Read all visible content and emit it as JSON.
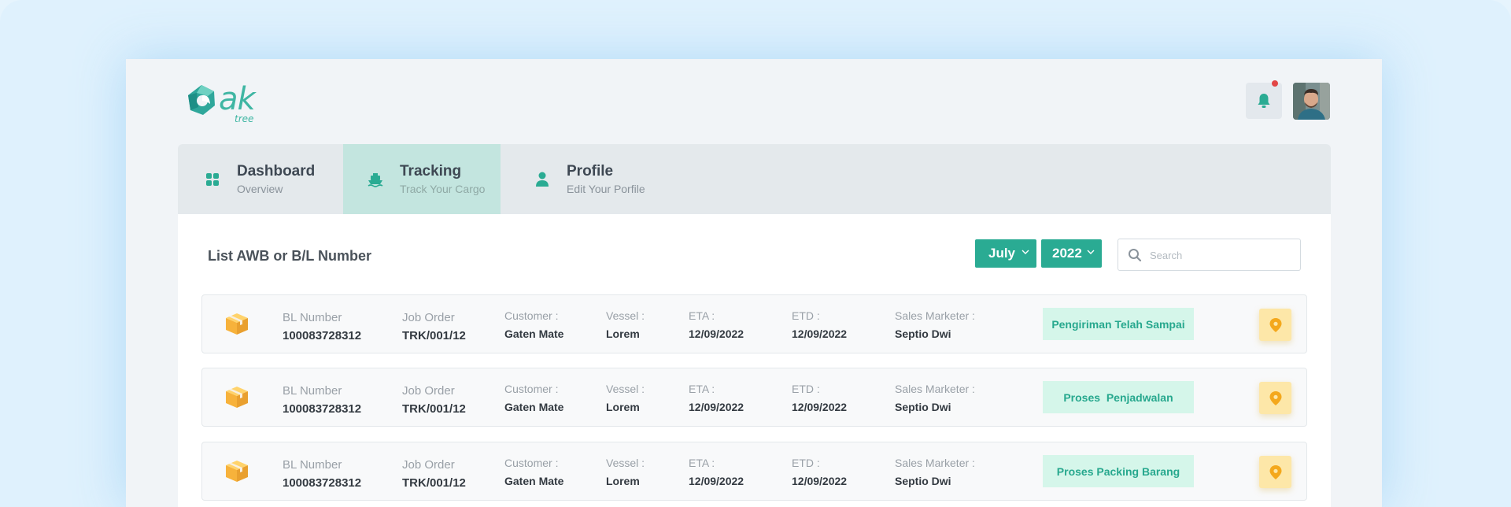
{
  "logo": {
    "word": "ak",
    "sub": "tree"
  },
  "tabs": [
    {
      "title": "Dashboard",
      "subtitle": "Overview"
    },
    {
      "title": "Tracking",
      "subtitle": "Track Your Cargo"
    },
    {
      "title": "Profile",
      "subtitle": "Edit Your Porfile"
    }
  ],
  "list_title": "List AWB or B/L Number",
  "filters": {
    "month": "July",
    "year": "2022"
  },
  "search": {
    "placeholder": "Search",
    "value": ""
  },
  "labels": {
    "bl": "BL Number",
    "job": "Job Order",
    "customer": "Customer :",
    "vessel": "Vessel :",
    "eta": "ETA :",
    "etd": "ETD :",
    "sales": "Sales Marketer :"
  },
  "rows": [
    {
      "bl": "100083728312",
      "job": "TRK/001/12",
      "customer": "Gaten Mate",
      "vessel": "Lorem",
      "eta": "12/09/2022",
      "etd": "12/09/2022",
      "sales": "Septio Dwi",
      "status": "Pengiriman Telah Sampai"
    },
    {
      "bl": "100083728312",
      "job": "TRK/001/12",
      "customer": "Gaten Mate",
      "vessel": "Lorem",
      "eta": "12/09/2022",
      "etd": "12/09/2022",
      "sales": "Septio Dwi",
      "status": "Proses  Penjadwalan"
    },
    {
      "bl": "100083728312",
      "job": "TRK/001/12",
      "customer": "Gaten Mate",
      "vessel": "Lorem",
      "eta": "12/09/2022",
      "etd": "12/09/2022",
      "sales": "Septio Dwi",
      "status": "Proses Packing Barang"
    }
  ],
  "colors": {
    "accent": "#2aab93",
    "status_bg": "#d5f6ea",
    "pin_bg": "#fde7a8",
    "notification_dot": "#e24646"
  },
  "icons": {
    "notification": "bell-icon",
    "location": "map-pin-icon",
    "cargo": "package-box-icon",
    "dashboard": "grid-icon",
    "tracking": "ship-icon",
    "profile": "user-icon"
  }
}
